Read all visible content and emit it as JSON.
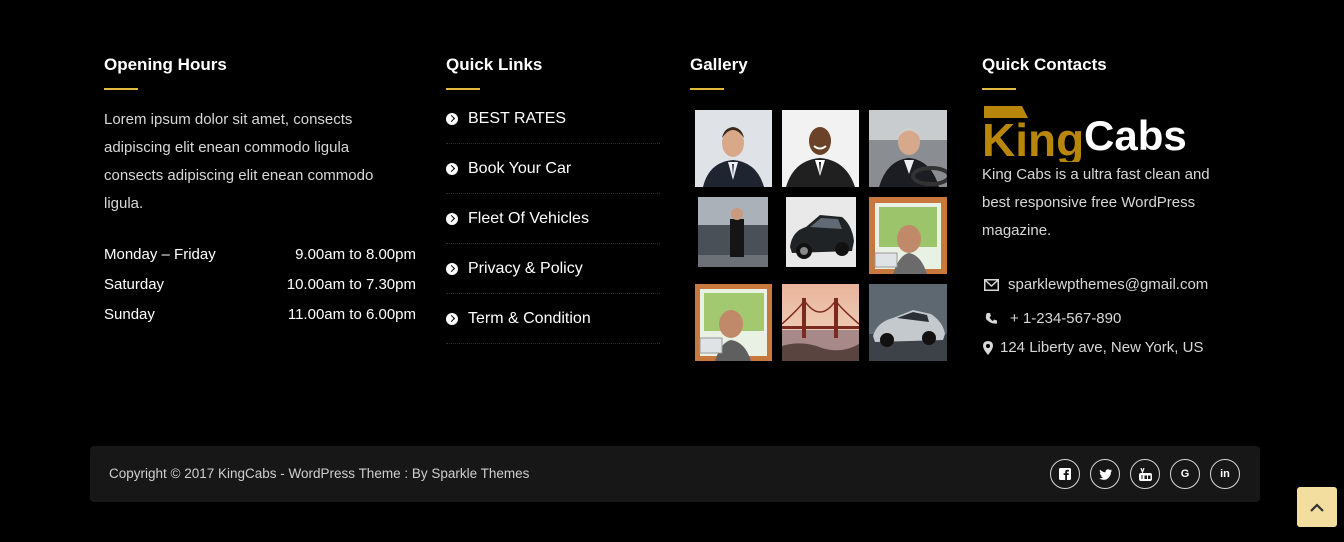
{
  "opening_hours": {
    "title": "Opening Hours",
    "text": "Lorem ipsum dolor sit amet, consects adipiscing elit enean commodo ligula consects adipiscing elit enean commodo ligula.",
    "rows": [
      {
        "day": "Monday – Friday",
        "time": "9.00am to 8.00pm"
      },
      {
        "day": "Saturday",
        "time": "10.00am to 7.30pm"
      },
      {
        "day": "Sunday",
        "time": "11.00am to 6.00pm"
      }
    ]
  },
  "quick_links": {
    "title": "Quick Links",
    "items": [
      "BEST RATES",
      "Book Your Car",
      "Fleet Of Vehicles",
      "Privacy & Policy",
      "Term & Condition"
    ]
  },
  "gallery": {
    "title": "Gallery",
    "images": [
      "businessman-portrait",
      "smiling-businessman",
      "man-driving",
      "man-standing-cars",
      "black-car",
      "driver-in-car",
      "driver-window",
      "golden-gate-bridge",
      "silver-sports-car"
    ]
  },
  "quick_contacts": {
    "title": "Quick Contacts",
    "logo_king": "King",
    "logo_cabs": "Cabs",
    "description": "King Cabs is a ultra fast clean and best responsive free WordPress magazine.",
    "email": "sparklewpthemes@gmail.com",
    "phone": "+ 1-234-567-890",
    "address": "124 Liberty ave, New York, US"
  },
  "footer": {
    "copyright": "Copyright © 2017 KingCabs - WordPress Theme : By Sparkle Themes",
    "social": [
      "facebook-icon",
      "twitter-icon",
      "youtube-icon",
      "google-icon",
      "linkedin-icon"
    ]
  },
  "colors": {
    "accent": "#e2b93b",
    "logo_gold": "#b8860b",
    "scroll_btn": "#f3dea0",
    "bar": "#171717"
  }
}
